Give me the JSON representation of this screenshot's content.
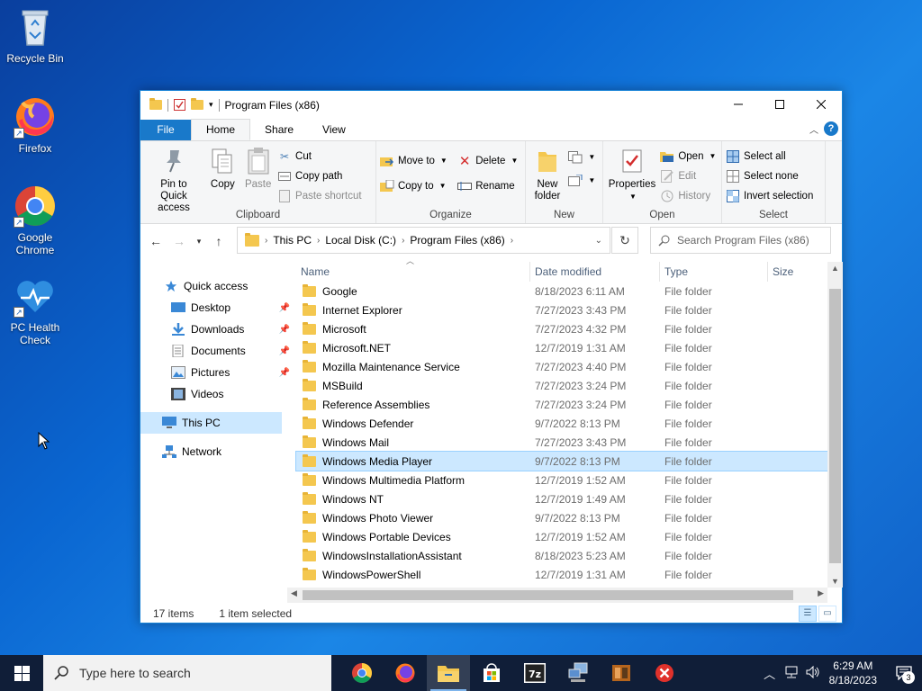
{
  "desktop": {
    "icons": [
      {
        "label": "Recycle Bin"
      },
      {
        "label": "Firefox"
      },
      {
        "label": "Google Chrome"
      },
      {
        "label": "PC Health Check"
      }
    ]
  },
  "window": {
    "title": "Program Files (x86)",
    "tabs": {
      "file": "File",
      "home": "Home",
      "share": "Share",
      "view": "View"
    },
    "ribbon": {
      "clipboard": {
        "label": "Clipboard",
        "pin": "Pin to Quick access",
        "copy": "Copy",
        "paste": "Paste",
        "cut": "Cut",
        "copy_path": "Copy path",
        "paste_shortcut": "Paste shortcut"
      },
      "organize": {
        "label": "Organize",
        "move_to": "Move to",
        "copy_to": "Copy to",
        "delete": "Delete",
        "rename": "Rename"
      },
      "new": {
        "label": "New",
        "new_folder": "New folder"
      },
      "open": {
        "label": "Open",
        "properties": "Properties",
        "open": "Open",
        "edit": "Edit",
        "history": "History"
      },
      "select": {
        "label": "Select",
        "select_all": "Select all",
        "select_none": "Select none",
        "invert": "Invert selection"
      }
    },
    "address": {
      "crumbs": [
        "This PC",
        "Local Disk (C:)",
        "Program Files (x86)"
      ],
      "search_placeholder": "Search Program Files (x86)"
    },
    "nav": {
      "quick_access": "Quick access",
      "items": [
        "Desktop",
        "Downloads",
        "Documents",
        "Pictures",
        "Videos"
      ],
      "this_pc": "This PC",
      "network": "Network"
    },
    "columns": {
      "name": "Name",
      "date": "Date modified",
      "type": "Type",
      "size": "Size"
    },
    "files": [
      {
        "name": "Google",
        "date": "8/18/2023 6:11 AM",
        "type": "File folder"
      },
      {
        "name": "Internet Explorer",
        "date": "7/27/2023 3:43 PM",
        "type": "File folder"
      },
      {
        "name": "Microsoft",
        "date": "7/27/2023 4:32 PM",
        "type": "File folder"
      },
      {
        "name": "Microsoft.NET",
        "date": "12/7/2019 1:31 AM",
        "type": "File folder"
      },
      {
        "name": "Mozilla Maintenance Service",
        "date": "7/27/2023 4:40 PM",
        "type": "File folder"
      },
      {
        "name": "MSBuild",
        "date": "7/27/2023 3:24 PM",
        "type": "File folder"
      },
      {
        "name": "Reference Assemblies",
        "date": "7/27/2023 3:24 PM",
        "type": "File folder"
      },
      {
        "name": "Windows Defender",
        "date": "9/7/2022 8:13 PM",
        "type": "File folder"
      },
      {
        "name": "Windows Mail",
        "date": "7/27/2023 3:43 PM",
        "type": "File folder"
      },
      {
        "name": "Windows Media Player",
        "date": "9/7/2022 8:13 PM",
        "type": "File folder",
        "selected": true
      },
      {
        "name": "Windows Multimedia Platform",
        "date": "12/7/2019 1:52 AM",
        "type": "File folder"
      },
      {
        "name": "Windows NT",
        "date": "12/7/2019 1:49 AM",
        "type": "File folder"
      },
      {
        "name": "Windows Photo Viewer",
        "date": "9/7/2022 8:13 PM",
        "type": "File folder"
      },
      {
        "name": "Windows Portable Devices",
        "date": "12/7/2019 1:52 AM",
        "type": "File folder"
      },
      {
        "name": "WindowsInstallationAssistant",
        "date": "8/18/2023 5:23 AM",
        "type": "File folder"
      },
      {
        "name": "WindowsPowerShell",
        "date": "12/7/2019 1:31 AM",
        "type": "File folder"
      }
    ],
    "status": {
      "count": "17 items",
      "selection": "1 item selected"
    }
  },
  "taskbar": {
    "search_placeholder": "Type here to search",
    "time": "6:29 AM",
    "date": "8/18/2023",
    "notifications": "3"
  }
}
